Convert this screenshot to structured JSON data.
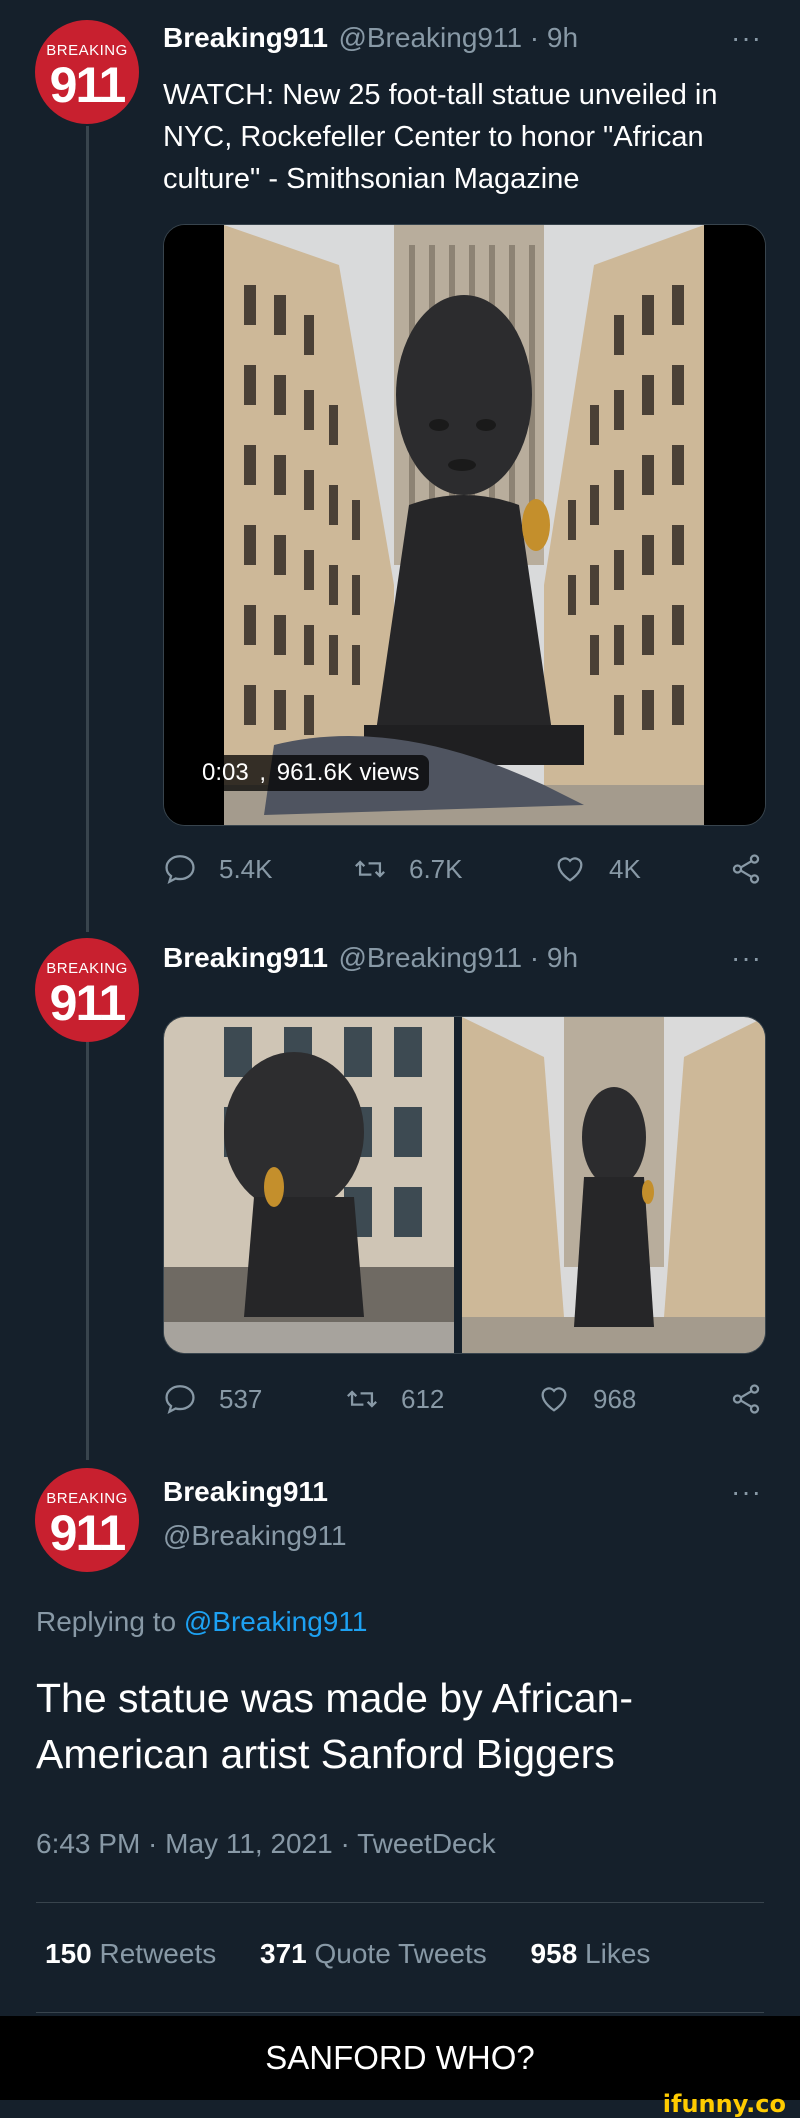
{
  "avatar": {
    "top_text": "BREAKING",
    "number": "911"
  },
  "tweet1": {
    "name": "Breaking911",
    "meta": "@Breaking911 · 9h",
    "text_line1": "WATCH: New 25 foot-tall statue unveiled in",
    "text_line2": "NYC, Rockefeller Center to honor \"African",
    "text_line3": "culture\" - Smithsonian Magazine",
    "video_time": "0:03",
    "video_views": "961.6K views",
    "replies": "5.4K",
    "retweets": "6.7K",
    "likes": "4K"
  },
  "tweet2": {
    "name": "Breaking911",
    "meta": "@Breaking911 · 9h",
    "replies": "537",
    "retweets": "612",
    "likes": "968"
  },
  "tweet3": {
    "name": "Breaking911",
    "handle": "@Breaking911",
    "replying_prefix": "Replying to",
    "replying_handle": "@Breaking911",
    "text_line1": "The statue was made by African-",
    "text_line2": "American artist Sanford Biggers",
    "timestamp": "6:43 PM · May 11, 2021 · TweetDeck",
    "retweets_count": "150",
    "retweets_label": "Retweets",
    "quotes_count": "371",
    "quotes_label": "Quote Tweets",
    "likes_count": "958",
    "likes_label": "Likes"
  },
  "more_label": "···",
  "caption": "SANFORD WHO?",
  "watermark": "ifunny.co",
  "colors": {
    "background": "#15202b",
    "secondary_text": "#8899a6",
    "link": "#1da1f2",
    "avatar_red": "#c8202f",
    "divider": "#38444d"
  }
}
